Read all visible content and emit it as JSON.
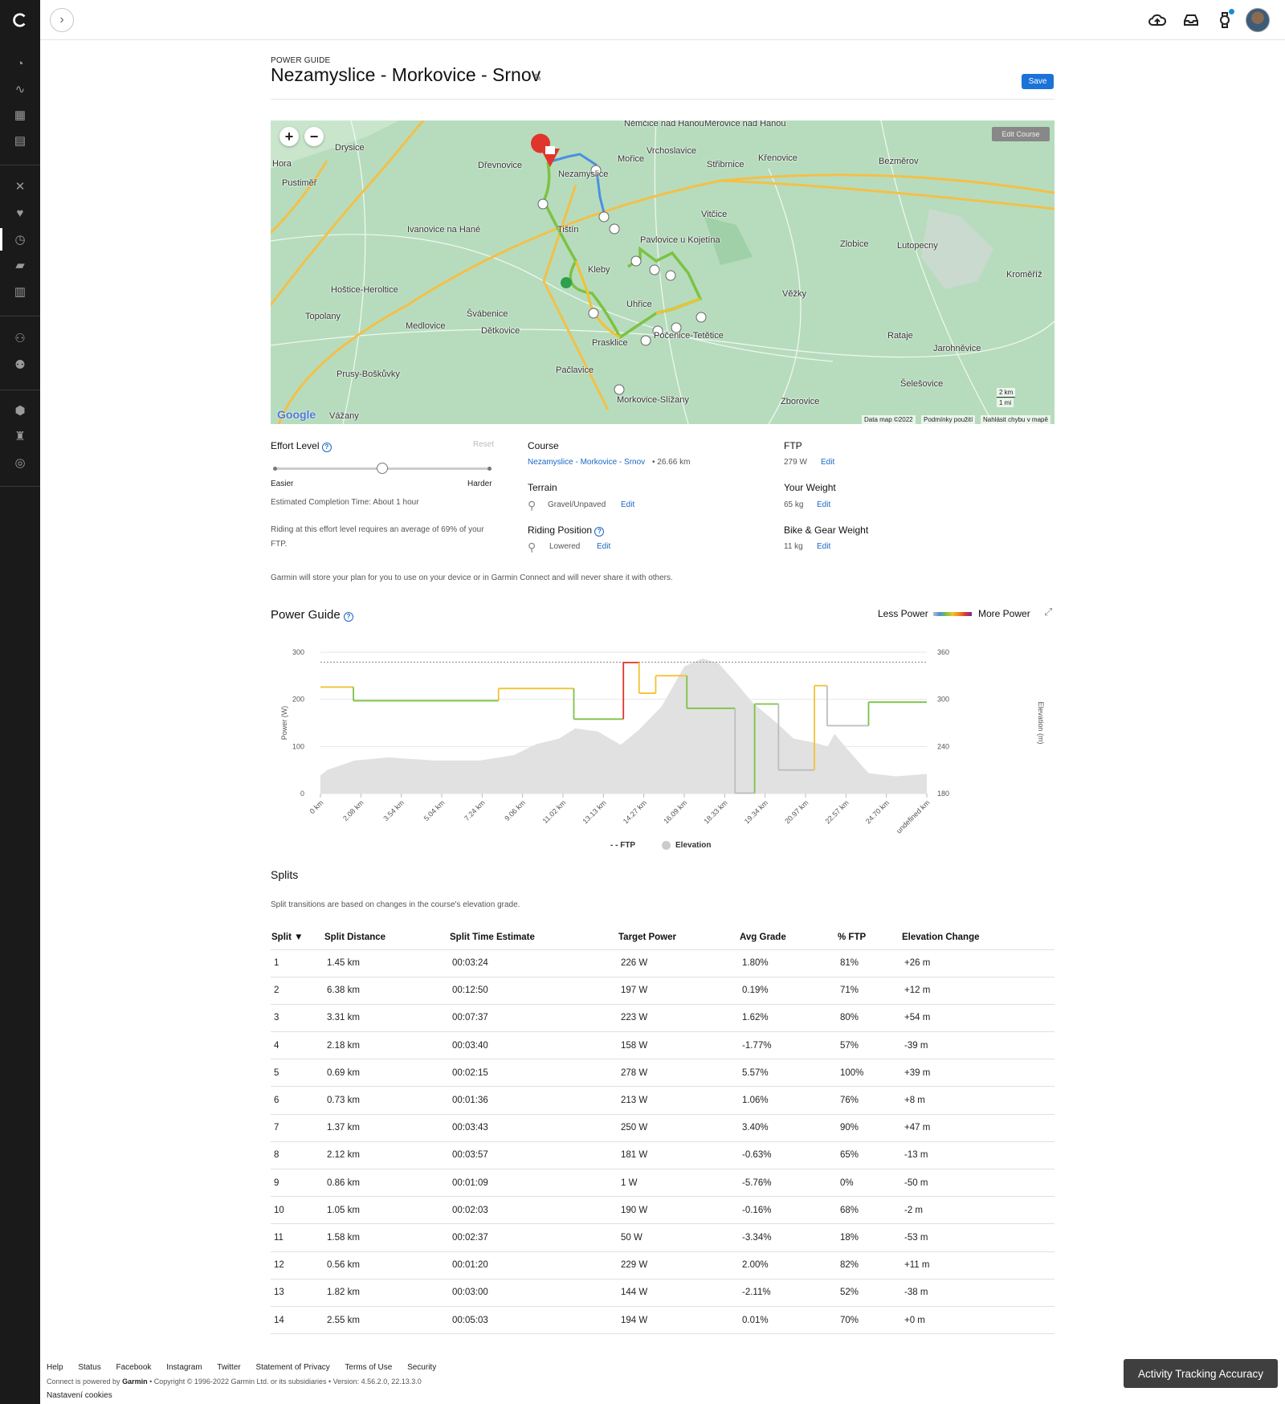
{
  "header": {
    "eyebrow": "POWER GUIDE",
    "title": "Nezamyslice - Morkovice - Srnov",
    "save_label": "Save"
  },
  "map": {
    "edit_course_label": "Edit Course",
    "attribution": "Data map ©2022",
    "terms": "Podmínky použití",
    "report": "Nahlásit chybu v mapě",
    "scale_km": "2 km",
    "scale_mi": "1 mi",
    "google": "Google",
    "places": [
      "Drysice",
      "Pustiměř",
      "Ivanovice na Hané",
      "Hoštice-Heroltice",
      "Topolany",
      "Medlovice",
      "Švábenice",
      "Dětkovice",
      "Prusy-Boškůvky",
      "Vážany",
      "Dřevnovice",
      "Nezamyslice",
      "Tištín",
      "Pavlovice u Kojetína",
      "Kleby",
      "Uhřice",
      "Prasklice",
      "Počenice-Tetětice",
      "Pačlavice",
      "Morkovice-Slížany",
      "Vrchoslavice",
      "Střibrnice",
      "Křenovice",
      "Vitčice",
      "Bezměrov",
      "Zlobice",
      "Lutopecny",
      "Kroměříž",
      "Věžky",
      "Rataje",
      "Jarohněvice",
      "Šelešovice",
      "Zborovice",
      "Mořice",
      "Němčice nad Hanou",
      "Měrovice nad Hanou",
      "Hora"
    ]
  },
  "settings": {
    "effort_label": "Effort Level",
    "reset_label": "Reset",
    "easier": "Easier",
    "harder": "Harder",
    "effort_level": 0.5,
    "completion": "Estimated Completion Time: About 1 hour",
    "riding_note": "Riding at this effort level requires an average of 69% of your FTP.",
    "course_label": "Course",
    "course_link": "Nezamyslice - Morkovice - Srnov",
    "course_distance": "• 26.66 km",
    "terrain_label": "Terrain",
    "terrain_value": "Gravel/Unpaved",
    "riding_label": "Riding Position",
    "riding_value": "Lowered",
    "ftp_label": "FTP",
    "ftp_value": "279 W",
    "weight_label": "Your Weight",
    "weight_value": "65 kg",
    "bike_label": "Bike & Gear Weight",
    "bike_value": "11 kg",
    "edit": "Edit",
    "privacy_note": "Garmin will store your plan for you to use on your device or in Garmin Connect and will never share it with others."
  },
  "power_guide": {
    "title": "Power Guide",
    "less": "Less Power",
    "more": "More Power",
    "legend_ftp": "- - FTP",
    "legend_elevation": "Elevation"
  },
  "chart_data": {
    "type": "line",
    "ylabel": "Power (W)",
    "y2label": "Elevation (m)",
    "ylim": [
      0,
      300
    ],
    "y2lim": [
      180,
      360
    ],
    "yticks": [
      0,
      100,
      200,
      300
    ],
    "y2ticks": [
      180,
      240,
      300,
      360
    ],
    "xticks": [
      "0 km",
      "2.08 km",
      "3.54 km",
      "5.04 km",
      "7.24 km",
      "9.06 km",
      "11.02 km",
      "13.13 km",
      "14.27 km",
      "16.09 km",
      "18.33 km",
      "19.34 km",
      "20.97 km",
      "22.57 km",
      "24.70 km",
      "undefined km"
    ],
    "ftp": 279,
    "series": [
      {
        "name": "Power",
        "segments": [
          {
            "x0": 0,
            "x1": 1.45,
            "y": 226
          },
          {
            "x0": 1.45,
            "x1": 7.83,
            "y": 197
          },
          {
            "x0": 7.83,
            "x1": 11.14,
            "y": 223
          },
          {
            "x0": 11.14,
            "x1": 13.32,
            "y": 158
          },
          {
            "x0": 13.32,
            "x1": 14.01,
            "y": 278
          },
          {
            "x0": 14.01,
            "x1": 14.74,
            "y": 213
          },
          {
            "x0": 14.74,
            "x1": 16.11,
            "y": 250
          },
          {
            "x0": 16.11,
            "x1": 18.23,
            "y": 181
          },
          {
            "x0": 18.23,
            "x1": 19.09,
            "y": 1
          },
          {
            "x0": 19.09,
            "x1": 20.14,
            "y": 190
          },
          {
            "x0": 20.14,
            "x1": 21.72,
            "y": 50
          },
          {
            "x0": 21.72,
            "x1": 22.28,
            "y": 229
          },
          {
            "x0": 22.28,
            "x1": 24.1,
            "y": 144
          },
          {
            "x0": 24.1,
            "x1": 26.66,
            "y": 194
          }
        ]
      },
      {
        "name": "Elevation",
        "x": [
          0,
          0.3,
          1.5,
          3.0,
          5.0,
          7.0,
          8.5,
          9.5,
          10.5,
          11.2,
          12.2,
          13.2,
          14.0,
          15.0,
          16.0,
          16.8,
          17.5,
          18.3,
          19.0,
          20.1,
          20.8,
          21.7,
          22.3,
          22.6,
          23.3,
          24.1,
          25.3,
          26.66
        ],
        "y": [
          203,
          210,
          222,
          226,
          222,
          222,
          229,
          243,
          250,
          263,
          259,
          242,
          261,
          291,
          342,
          352,
          346,
          320,
          296,
          269,
          250,
          245,
          240,
          256,
          232,
          206,
          202,
          205
        ]
      }
    ]
  },
  "splits": {
    "title": "Splits",
    "note": "Split transitions are based on changes in the course's elevation grade.",
    "columns": [
      "Split ▼",
      "Split Distance",
      "Split Time Estimate",
      "Target Power",
      "Avg Grade",
      "% FTP",
      "Elevation Change"
    ],
    "rows": [
      [
        "1",
        "1.45 km",
        "00:03:24",
        "226 W",
        "1.80%",
        "81%",
        "+26 m"
      ],
      [
        "2",
        "6.38 km",
        "00:12:50",
        "197 W",
        "0.19%",
        "71%",
        "+12 m"
      ],
      [
        "3",
        "3.31 km",
        "00:07:37",
        "223 W",
        "1.62%",
        "80%",
        "+54 m"
      ],
      [
        "4",
        "2.18 km",
        "00:03:40",
        "158 W",
        "-1.77%",
        "57%",
        "-39 m"
      ],
      [
        "5",
        "0.69 km",
        "00:02:15",
        "278 W",
        "5.57%",
        "100%",
        "+39 m"
      ],
      [
        "6",
        "0.73 km",
        "00:01:36",
        "213 W",
        "1.06%",
        "76%",
        "+8 m"
      ],
      [
        "7",
        "1.37 km",
        "00:03:43",
        "250 W",
        "3.40%",
        "90%",
        "+47 m"
      ],
      [
        "8",
        "2.12 km",
        "00:03:57",
        "181 W",
        "-0.63%",
        "65%",
        "-13 m"
      ],
      [
        "9",
        "0.86 km",
        "00:01:09",
        "1 W",
        "-5.76%",
        "0%",
        "-50 m"
      ],
      [
        "10",
        "1.05 km",
        "00:02:03",
        "190 W",
        "-0.16%",
        "68%",
        "-2 m"
      ],
      [
        "11",
        "1.58 km",
        "00:02:37",
        "50 W",
        "-3.34%",
        "18%",
        "-53 m"
      ],
      [
        "12",
        "0.56 km",
        "00:01:20",
        "229 W",
        "2.00%",
        "82%",
        "+11 m"
      ],
      [
        "13",
        "1.82 km",
        "00:03:00",
        "144 W",
        "-2.11%",
        "52%",
        "-38 m"
      ],
      [
        "14",
        "2.55 km",
        "00:05:03",
        "194 W",
        "0.01%",
        "70%",
        "+0 m"
      ]
    ]
  },
  "footer": {
    "links": [
      "Help",
      "Status",
      "Facebook",
      "Instagram",
      "Twitter",
      "Statement of Privacy",
      "Terms of Use",
      "Security"
    ],
    "copy_prefix": "Connect is powered by",
    "copy_brand": "Garmin",
    "copy_suffix": "• Copyright © 1996-2022 Garmin Ltd. or its subsidiaries • Version: 4.56.2.0, 22.13.3.0",
    "cookies": "Nastavení cookies",
    "accuracy_button": "Activity Tracking Accuracy"
  },
  "colors": {
    "accent": "#1a73d8",
    "sidebar": "#1a1a1a",
    "power_gray": "#bdbdbd",
    "power_blue": "#4a90e2",
    "power_green": "#7cc243",
    "power_yellow": "#f2c230",
    "power_orange": "#f08a24",
    "power_red": "#e0352b",
    "power_purple": "#6b2fa8"
  }
}
